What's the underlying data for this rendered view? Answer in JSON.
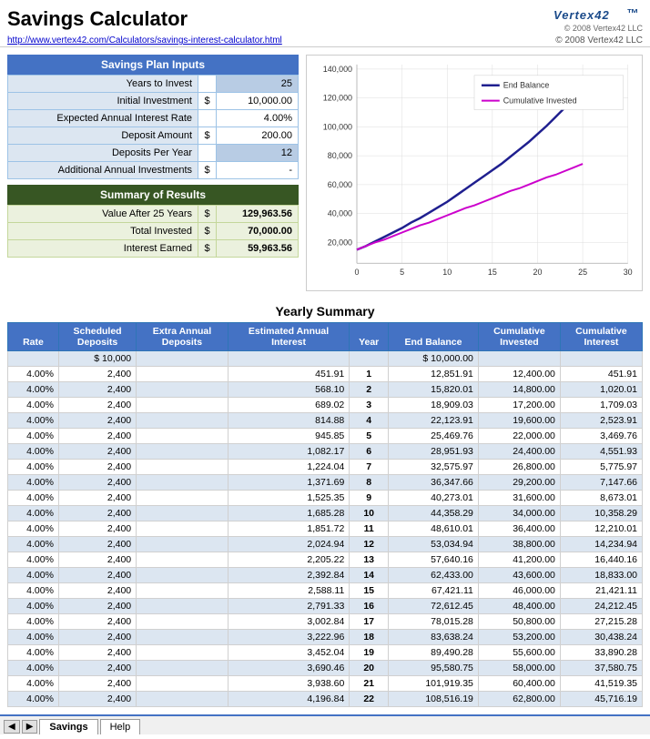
{
  "header": {
    "title": "Savings Calculator",
    "logo": "Vertex42",
    "copyright": "© 2008 Vertex42 LLC",
    "link_text": "http://www.vertex42.com/Calculators/savings-interest-calculator.html"
  },
  "inputs": {
    "section_title": "Savings Plan Inputs",
    "fields": [
      {
        "label": "Years to Invest",
        "dollar": "",
        "value": "25",
        "blue": true
      },
      {
        "label": "Initial Investment",
        "dollar": "$",
        "value": "10,000.00",
        "blue": false
      },
      {
        "label": "Expected Annual Interest Rate",
        "dollar": "",
        "value": "4.00%",
        "blue": false
      },
      {
        "label": "Deposit Amount",
        "dollar": "$",
        "value": "200.00",
        "blue": false
      },
      {
        "label": "Deposits Per Year",
        "dollar": "",
        "value": "12",
        "blue": true
      },
      {
        "label": "Additional Annual Investments",
        "dollar": "$",
        "value": "-",
        "blue": false
      }
    ]
  },
  "summary": {
    "section_title": "Summary of Results",
    "fields": [
      {
        "label": "Value After 25 Years",
        "dollar": "$",
        "value": "129,963.56"
      },
      {
        "label": "Total Invested",
        "dollar": "$",
        "value": "70,000.00"
      },
      {
        "label": "Interest Earned",
        "dollar": "$",
        "value": "59,963.56"
      }
    ]
  },
  "chart": {
    "legend": [
      {
        "label": "End Balance",
        "color": "#1f1f8f"
      },
      {
        "label": "Cumulative Invested",
        "color": "#cc00cc"
      }
    ],
    "y_labels": [
      "140,000",
      "120,000",
      "100,000",
      "80,000",
      "60,000",
      "40,000",
      "20,000",
      ""
    ],
    "x_labels": [
      "0",
      "5",
      "10",
      "15",
      "20",
      "25",
      "30"
    ]
  },
  "yearly_summary": {
    "title": "Yearly Summary",
    "columns": [
      "Rate",
      "Scheduled\nDeposits",
      "Extra Annual\nDeposits",
      "Estimated Annual\nInterest",
      "Year",
      "End Balance",
      "Cumulative\nInvested",
      "Cumulative\nInterest"
    ],
    "rows": [
      {
        "rate": "",
        "scheduled": "$ 10,000",
        "extra": "",
        "interest": "",
        "year": "",
        "end_balance": "$ 10,000.00",
        "cum_invested": "",
        "cum_interest": ""
      },
      {
        "rate": "4.00%",
        "scheduled": "2,400",
        "extra": "",
        "interest": "451.91",
        "year": "1",
        "end_balance": "12,851.91",
        "cum_invested": "12,400.00",
        "cum_interest": "451.91"
      },
      {
        "rate": "4.00%",
        "scheduled": "2,400",
        "extra": "",
        "interest": "568.10",
        "year": "2",
        "end_balance": "15,820.01",
        "cum_invested": "14,800.00",
        "cum_interest": "1,020.01"
      },
      {
        "rate": "4.00%",
        "scheduled": "2,400",
        "extra": "",
        "interest": "689.02",
        "year": "3",
        "end_balance": "18,909.03",
        "cum_invested": "17,200.00",
        "cum_interest": "1,709.03"
      },
      {
        "rate": "4.00%",
        "scheduled": "2,400",
        "extra": "",
        "interest": "814.88",
        "year": "4",
        "end_balance": "22,123.91",
        "cum_invested": "19,600.00",
        "cum_interest": "2,523.91"
      },
      {
        "rate": "4.00%",
        "scheduled": "2,400",
        "extra": "",
        "interest": "945.85",
        "year": "5",
        "end_balance": "25,469.76",
        "cum_invested": "22,000.00",
        "cum_interest": "3,469.76"
      },
      {
        "rate": "4.00%",
        "scheduled": "2,400",
        "extra": "",
        "interest": "1,082.17",
        "year": "6",
        "end_balance": "28,951.93",
        "cum_invested": "24,400.00",
        "cum_interest": "4,551.93"
      },
      {
        "rate": "4.00%",
        "scheduled": "2,400",
        "extra": "",
        "interest": "1,224.04",
        "year": "7",
        "end_balance": "32,575.97",
        "cum_invested": "26,800.00",
        "cum_interest": "5,775.97"
      },
      {
        "rate": "4.00%",
        "scheduled": "2,400",
        "extra": "",
        "interest": "1,371.69",
        "year": "8",
        "end_balance": "36,347.66",
        "cum_invested": "29,200.00",
        "cum_interest": "7,147.66"
      },
      {
        "rate": "4.00%",
        "scheduled": "2,400",
        "extra": "",
        "interest": "1,525.35",
        "year": "9",
        "end_balance": "40,273.01",
        "cum_invested": "31,600.00",
        "cum_interest": "8,673.01"
      },
      {
        "rate": "4.00%",
        "scheduled": "2,400",
        "extra": "",
        "interest": "1,685.28",
        "year": "10",
        "end_balance": "44,358.29",
        "cum_invested": "34,000.00",
        "cum_interest": "10,358.29"
      },
      {
        "rate": "4.00%",
        "scheduled": "2,400",
        "extra": "",
        "interest": "1,851.72",
        "year": "11",
        "end_balance": "48,610.01",
        "cum_invested": "36,400.00",
        "cum_interest": "12,210.01"
      },
      {
        "rate": "4.00%",
        "scheduled": "2,400",
        "extra": "",
        "interest": "2,024.94",
        "year": "12",
        "end_balance": "53,034.94",
        "cum_invested": "38,800.00",
        "cum_interest": "14,234.94"
      },
      {
        "rate": "4.00%",
        "scheduled": "2,400",
        "extra": "",
        "interest": "2,205.22",
        "year": "13",
        "end_balance": "57,640.16",
        "cum_invested": "41,200.00",
        "cum_interest": "16,440.16"
      },
      {
        "rate": "4.00%",
        "scheduled": "2,400",
        "extra": "",
        "interest": "2,392.84",
        "year": "14",
        "end_balance": "62,433.00",
        "cum_invested": "43,600.00",
        "cum_interest": "18,833.00"
      },
      {
        "rate": "4.00%",
        "scheduled": "2,400",
        "extra": "",
        "interest": "2,588.11",
        "year": "15",
        "end_balance": "67,421.11",
        "cum_invested": "46,000.00",
        "cum_interest": "21,421.11"
      },
      {
        "rate": "4.00%",
        "scheduled": "2,400",
        "extra": "",
        "interest": "2,791.33",
        "year": "16",
        "end_balance": "72,612.45",
        "cum_invested": "48,400.00",
        "cum_interest": "24,212.45"
      },
      {
        "rate": "4.00%",
        "scheduled": "2,400",
        "extra": "",
        "interest": "3,002.84",
        "year": "17",
        "end_balance": "78,015.28",
        "cum_invested": "50,800.00",
        "cum_interest": "27,215.28"
      },
      {
        "rate": "4.00%",
        "scheduled": "2,400",
        "extra": "",
        "interest": "3,222.96",
        "year": "18",
        "end_balance": "83,638.24",
        "cum_invested": "53,200.00",
        "cum_interest": "30,438.24"
      },
      {
        "rate": "4.00%",
        "scheduled": "2,400",
        "extra": "",
        "interest": "3,452.04",
        "year": "19",
        "end_balance": "89,490.28",
        "cum_invested": "55,600.00",
        "cum_interest": "33,890.28"
      },
      {
        "rate": "4.00%",
        "scheduled": "2,400",
        "extra": "",
        "interest": "3,690.46",
        "year": "20",
        "end_balance": "95,580.75",
        "cum_invested": "58,000.00",
        "cum_interest": "37,580.75"
      },
      {
        "rate": "4.00%",
        "scheduled": "2,400",
        "extra": "",
        "interest": "3,938.60",
        "year": "21",
        "end_balance": "101,919.35",
        "cum_invested": "60,400.00",
        "cum_interest": "41,519.35"
      },
      {
        "rate": "4.00%",
        "scheduled": "2,400",
        "extra": "",
        "interest": "4,196.84",
        "year": "22",
        "end_balance": "108,516.19",
        "cum_invested": "62,800.00",
        "cum_interest": "45,716.19"
      }
    ]
  },
  "tabs": [
    {
      "label": "Savings",
      "active": true
    },
    {
      "label": "Help",
      "active": false
    }
  ]
}
